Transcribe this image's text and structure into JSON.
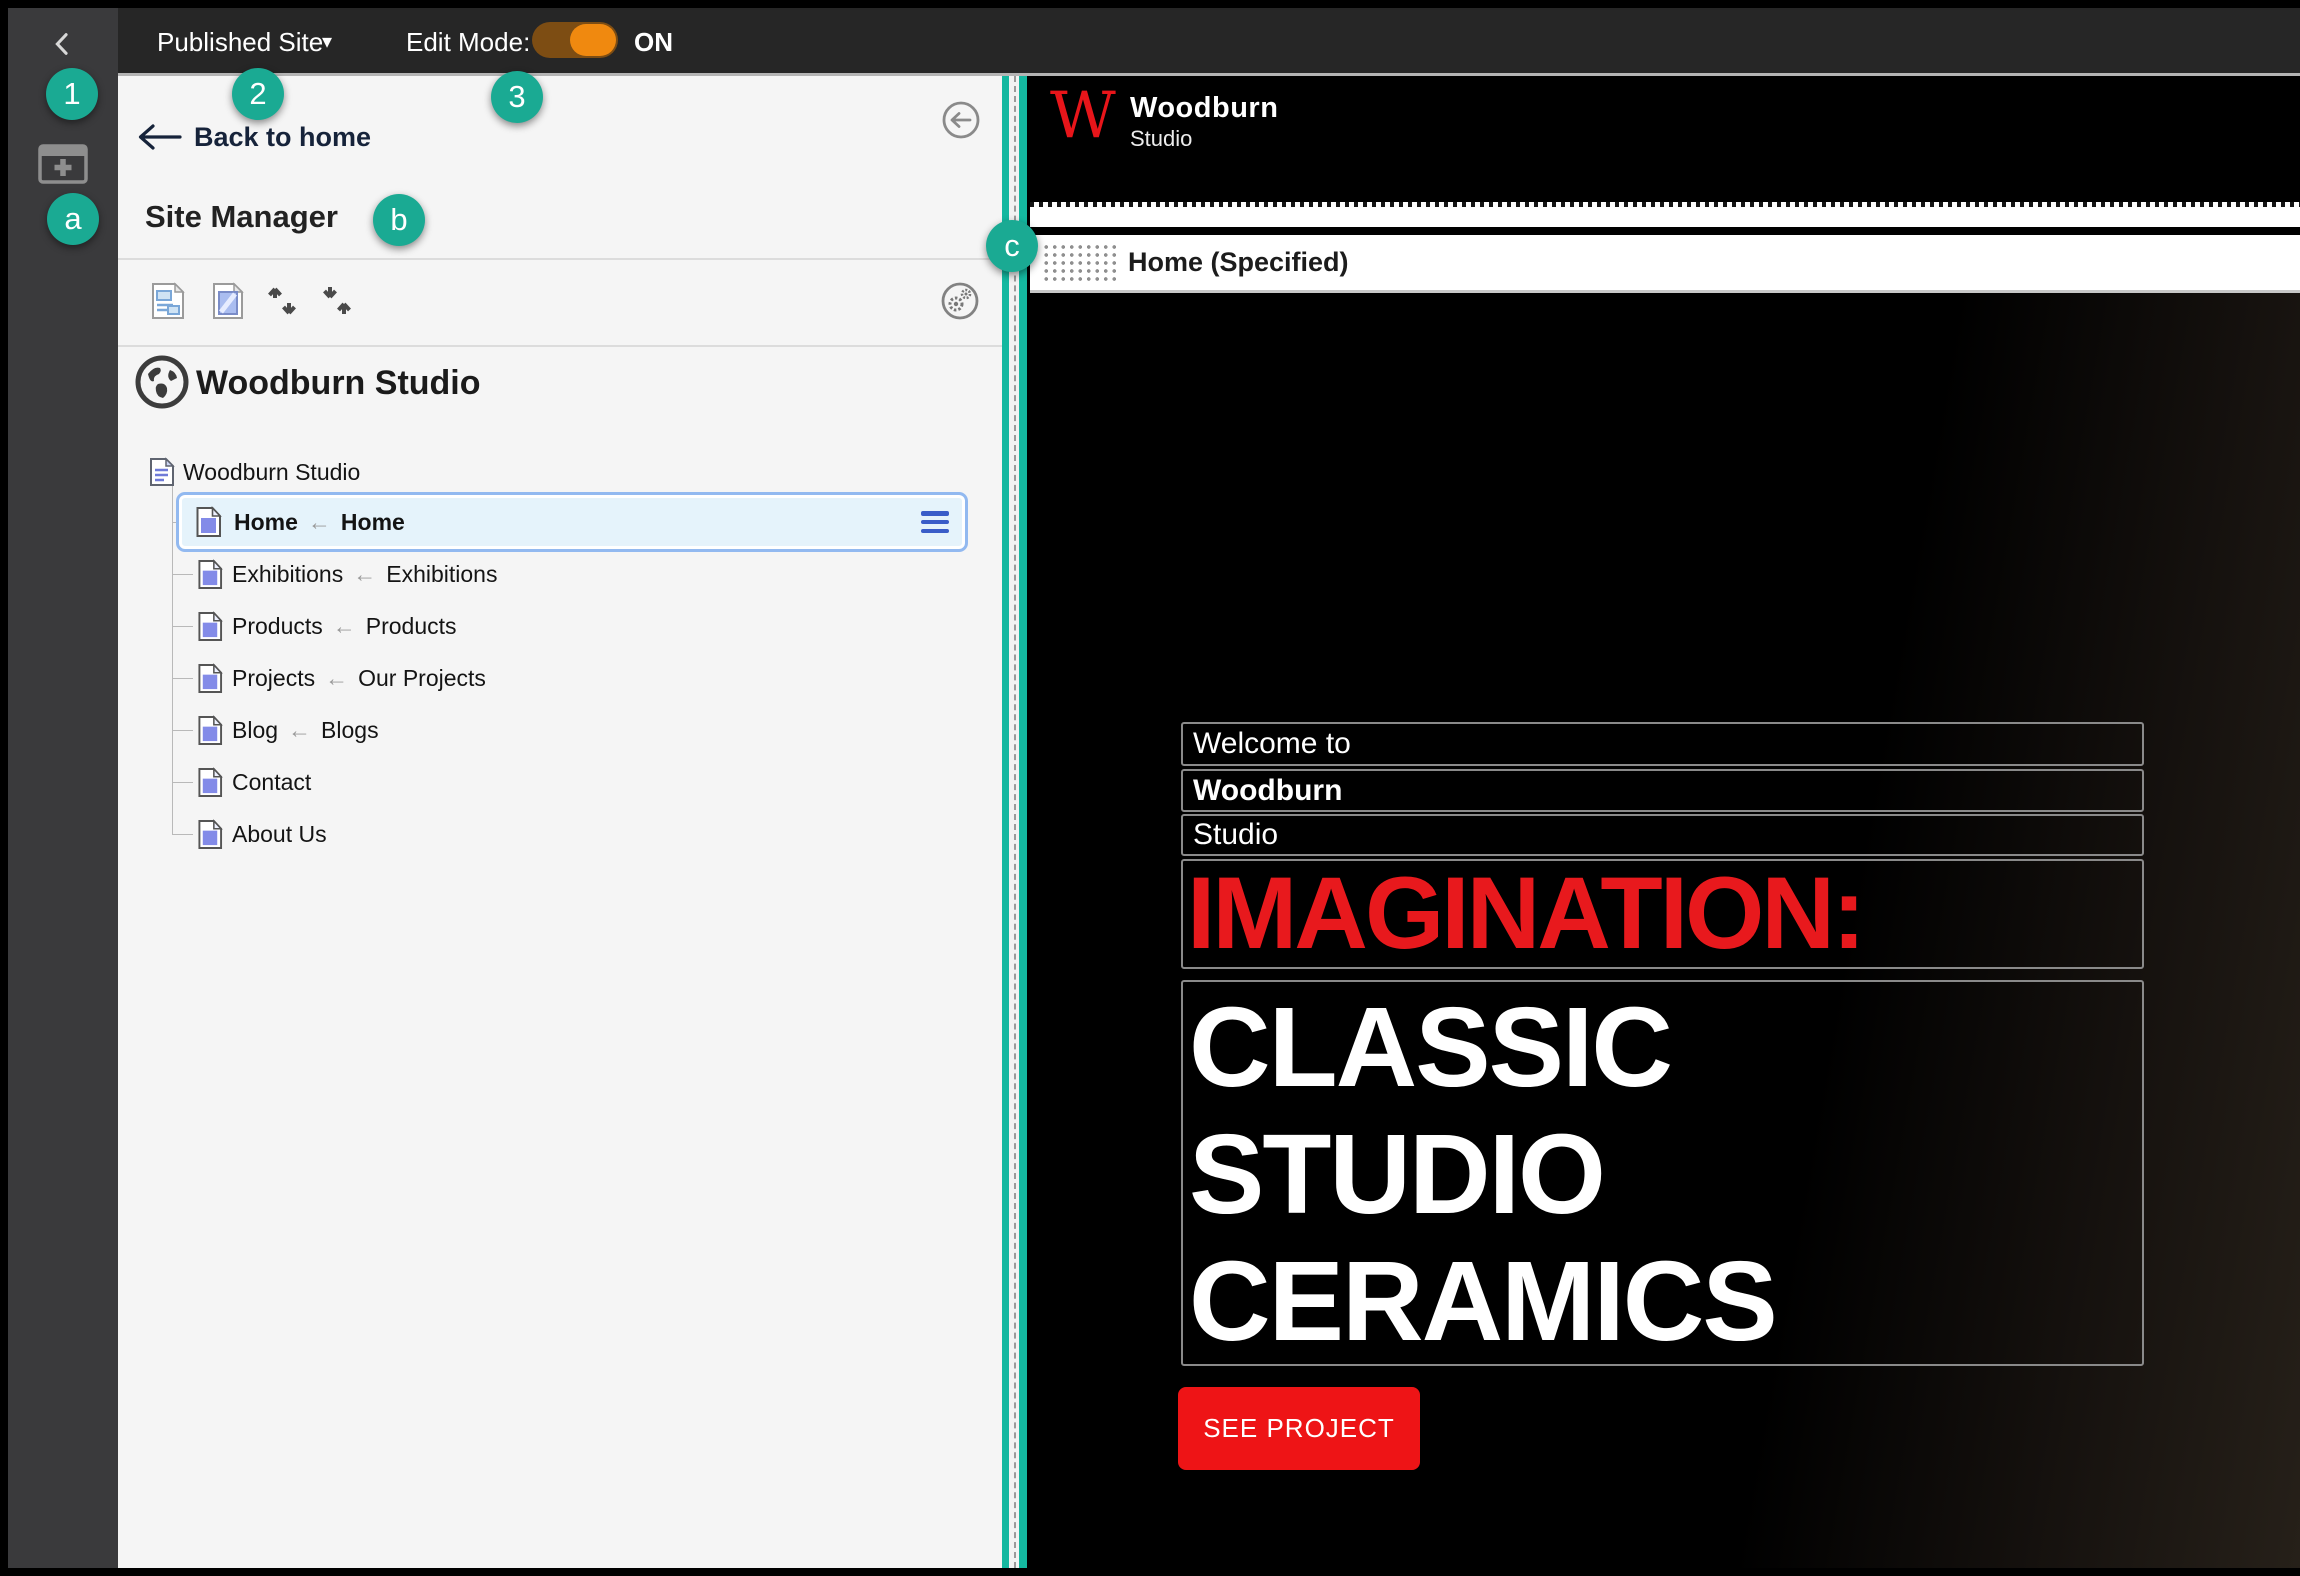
{
  "topbar": {
    "published_site": "Published Site",
    "caret": "▾",
    "edit_mode_label": "Edit Mode:",
    "toggle_state": "ON"
  },
  "badges": {
    "b1": "1",
    "b2": "2",
    "b3": "3",
    "ba": "a",
    "bb": "b",
    "bc": "c"
  },
  "panel": {
    "back_label": "Back to home",
    "title": "Site Manager",
    "site_title": "Woodburn Studio",
    "tree": {
      "root": "Woodburn Studio",
      "items": [
        {
          "name": "Home",
          "arrow": "←",
          "target": "Home"
        },
        {
          "name": "Exhibitions",
          "arrow": "←",
          "target": "Exhibitions"
        },
        {
          "name": "Products",
          "arrow": "←",
          "target": "Products"
        },
        {
          "name": "Projects",
          "arrow": "←",
          "target": "Our Projects"
        },
        {
          "name": "Blog",
          "arrow": "←",
          "target": "Blogs"
        },
        {
          "name": "Contact"
        },
        {
          "name": "About Us"
        }
      ]
    }
  },
  "preview": {
    "logo_monogram": "W",
    "logo_name": "Woodburn",
    "logo_sub": "Studio",
    "section_label": "Home (Specified)",
    "hero_line1": "Welcome to",
    "hero_line2": "Woodburn",
    "hero_line3": "Studio",
    "highlight": "IMAGINATION:",
    "headline_1": "CLASSIC",
    "headline_2": "STUDIO",
    "headline_3": "CERAMICS",
    "button_label": "SEE PROJECT"
  },
  "colors": {
    "badge_teal": "#1aaa93",
    "toggle_orange": "#f0890f",
    "accent_red": "#e8191d",
    "button_red": "#ee1416",
    "selection_blue": "#92b9f0"
  }
}
